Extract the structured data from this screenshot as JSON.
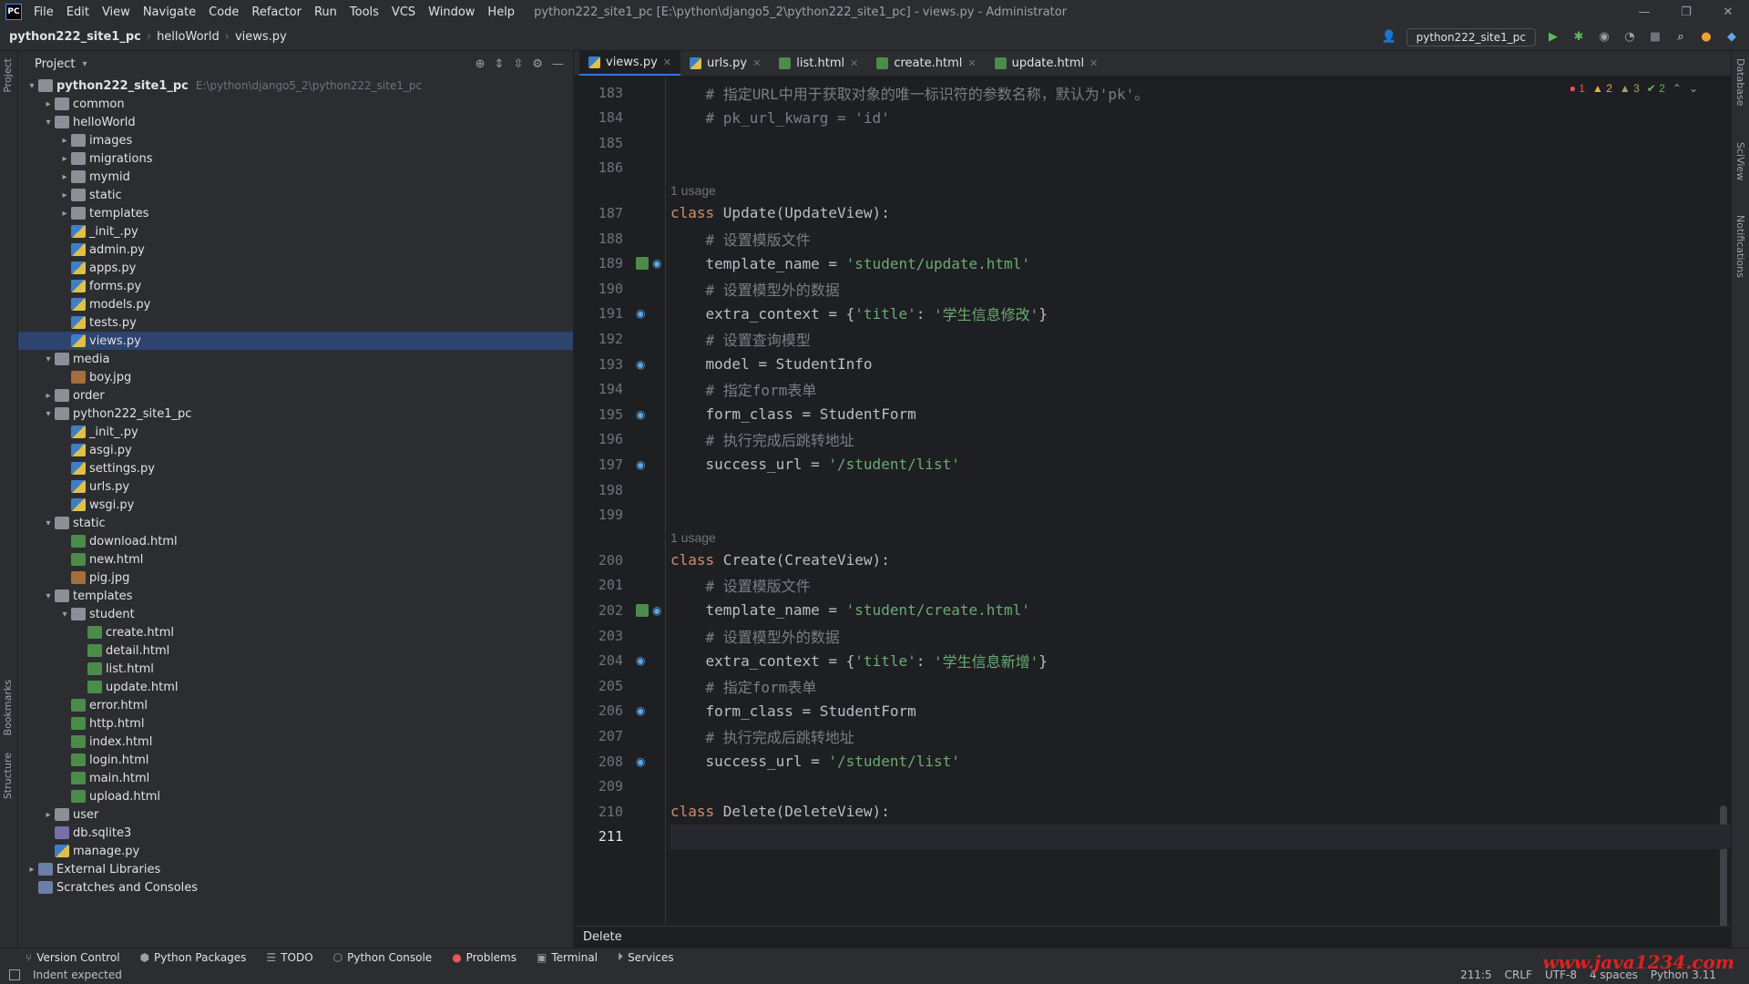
{
  "app": {
    "logo": "PC",
    "menu": [
      "File",
      "Edit",
      "View",
      "Navigate",
      "Code",
      "Refactor",
      "Run",
      "Tools",
      "VCS",
      "Window",
      "Help"
    ],
    "window_title": "python222_site1_pc [E:\\python\\django5_2\\python222_site1_pc] - views.py - Administrator"
  },
  "nav": {
    "crumbs": [
      "python222_site1_pc",
      "helloWorld",
      "views.py"
    ],
    "run_config": "python222_site1_pc"
  },
  "project": {
    "title": "Project",
    "tree": [
      {
        "depth": 0,
        "arrow": "▾",
        "icon": "folder",
        "label": "python222_site1_pc",
        "path": "E:\\python\\django5_2\\python222_site1_pc",
        "bold": true
      },
      {
        "depth": 1,
        "arrow": "▸",
        "icon": "folder",
        "label": "common"
      },
      {
        "depth": 1,
        "arrow": "▾",
        "icon": "folder",
        "label": "helloWorld"
      },
      {
        "depth": 2,
        "arrow": "▸",
        "icon": "folder",
        "label": "images"
      },
      {
        "depth": 2,
        "arrow": "▸",
        "icon": "folder",
        "label": "migrations"
      },
      {
        "depth": 2,
        "arrow": "▸",
        "icon": "folder",
        "label": "mymid"
      },
      {
        "depth": 2,
        "arrow": "▸",
        "icon": "folder",
        "label": "static"
      },
      {
        "depth": 2,
        "arrow": "▸",
        "icon": "folder",
        "label": "templates"
      },
      {
        "depth": 2,
        "arrow": "",
        "icon": "py",
        "label": "_init_.py"
      },
      {
        "depth": 2,
        "arrow": "",
        "icon": "py",
        "label": "admin.py"
      },
      {
        "depth": 2,
        "arrow": "",
        "icon": "py",
        "label": "apps.py"
      },
      {
        "depth": 2,
        "arrow": "",
        "icon": "py",
        "label": "forms.py"
      },
      {
        "depth": 2,
        "arrow": "",
        "icon": "py",
        "label": "models.py"
      },
      {
        "depth": 2,
        "arrow": "",
        "icon": "py",
        "label": "tests.py"
      },
      {
        "depth": 2,
        "arrow": "",
        "icon": "py",
        "label": "views.py",
        "selected": true
      },
      {
        "depth": 1,
        "arrow": "▾",
        "icon": "folder",
        "label": "media"
      },
      {
        "depth": 2,
        "arrow": "",
        "icon": "img",
        "label": "boy.jpg"
      },
      {
        "depth": 1,
        "arrow": "▸",
        "icon": "folder",
        "label": "order"
      },
      {
        "depth": 1,
        "arrow": "▾",
        "icon": "folder",
        "label": "python222_site1_pc"
      },
      {
        "depth": 2,
        "arrow": "",
        "icon": "py",
        "label": "_init_.py"
      },
      {
        "depth": 2,
        "arrow": "",
        "icon": "py",
        "label": "asgi.py"
      },
      {
        "depth": 2,
        "arrow": "",
        "icon": "py",
        "label": "settings.py"
      },
      {
        "depth": 2,
        "arrow": "",
        "icon": "py",
        "label": "urls.py"
      },
      {
        "depth": 2,
        "arrow": "",
        "icon": "py",
        "label": "wsgi.py"
      },
      {
        "depth": 1,
        "arrow": "▾",
        "icon": "folder",
        "label": "static"
      },
      {
        "depth": 2,
        "arrow": "",
        "icon": "html",
        "label": "download.html"
      },
      {
        "depth": 2,
        "arrow": "",
        "icon": "html",
        "label": "new.html"
      },
      {
        "depth": 2,
        "arrow": "",
        "icon": "img",
        "label": "pig.jpg"
      },
      {
        "depth": 1,
        "arrow": "▾",
        "icon": "folder",
        "label": "templates"
      },
      {
        "depth": 2,
        "arrow": "▾",
        "icon": "folder",
        "label": "student"
      },
      {
        "depth": 3,
        "arrow": "",
        "icon": "html",
        "label": "create.html"
      },
      {
        "depth": 3,
        "arrow": "",
        "icon": "html",
        "label": "detail.html"
      },
      {
        "depth": 3,
        "arrow": "",
        "icon": "html",
        "label": "list.html"
      },
      {
        "depth": 3,
        "arrow": "",
        "icon": "html",
        "label": "update.html"
      },
      {
        "depth": 2,
        "arrow": "",
        "icon": "html",
        "label": "error.html"
      },
      {
        "depth": 2,
        "arrow": "",
        "icon": "html",
        "label": "http.html"
      },
      {
        "depth": 2,
        "arrow": "",
        "icon": "html",
        "label": "index.html"
      },
      {
        "depth": 2,
        "arrow": "",
        "icon": "html",
        "label": "login.html"
      },
      {
        "depth": 2,
        "arrow": "",
        "icon": "html",
        "label": "main.html"
      },
      {
        "depth": 2,
        "arrow": "",
        "icon": "html",
        "label": "upload.html"
      },
      {
        "depth": 1,
        "arrow": "▸",
        "icon": "folder",
        "label": "user"
      },
      {
        "depth": 1,
        "arrow": "",
        "icon": "db",
        "label": "db.sqlite3"
      },
      {
        "depth": 1,
        "arrow": "",
        "icon": "py",
        "label": "manage.py"
      },
      {
        "depth": 0,
        "arrow": "▸",
        "icon": "lib",
        "label": "External Libraries"
      },
      {
        "depth": 0,
        "arrow": "",
        "icon": "lib",
        "label": "Scratches and Consoles"
      }
    ]
  },
  "tabs": [
    {
      "label": "views.py",
      "icon": "py",
      "active": true
    },
    {
      "label": "urls.py",
      "icon": "py"
    },
    {
      "label": "list.html",
      "icon": "html"
    },
    {
      "label": "create.html",
      "icon": "html"
    },
    {
      "label": "update.html",
      "icon": "html"
    }
  ],
  "inspections": {
    "errors": "1",
    "warnings": "2",
    "weak_warnings": "3",
    "ok": "2"
  },
  "code": {
    "lines": [
      {
        "n": "183",
        "parts": [
          [
            "cmt",
            "    # 指定URL中用于获取对象的唯一标识符的参数名称，默认为'pk'。"
          ]
        ]
      },
      {
        "n": "184",
        "parts": [
          [
            "cmt",
            "    # pk_url_kwarg = 'id'"
          ]
        ]
      },
      {
        "n": "185",
        "parts": []
      },
      {
        "n": "186",
        "parts": []
      },
      {
        "n": "187",
        "parts": [
          [
            "kw",
            "class "
          ],
          [
            "cls",
            "Update(UpdateView):"
          ]
        ],
        "usage_before": "1 usage"
      },
      {
        "n": "188",
        "parts": [
          [
            "cmt",
            "    # 设置模版文件"
          ]
        ]
      },
      {
        "n": "189",
        "parts": [
          [
            "cls",
            "    template_name = "
          ],
          [
            "str",
            "'student/update.html'"
          ]
        ],
        "marks": [
          "impl",
          "override"
        ]
      },
      {
        "n": "190",
        "parts": [
          [
            "cmt",
            "    # 设置模型外的数据"
          ]
        ]
      },
      {
        "n": "191",
        "parts": [
          [
            "cls",
            "    extra_context = {"
          ],
          [
            "str",
            "'title'"
          ],
          [
            "cls",
            ": "
          ],
          [
            "str",
            "'学生信息修改'"
          ],
          [
            "cls",
            "}"
          ]
        ],
        "marks": [
          "override"
        ]
      },
      {
        "n": "192",
        "parts": [
          [
            "cmt",
            "    # 设置查询模型"
          ]
        ]
      },
      {
        "n": "193",
        "parts": [
          [
            "cls",
            "    model = StudentInfo"
          ]
        ],
        "marks": [
          "override"
        ]
      },
      {
        "n": "194",
        "parts": [
          [
            "cmt",
            "    # 指定form表单"
          ]
        ]
      },
      {
        "n": "195",
        "parts": [
          [
            "cls",
            "    form_class = StudentForm"
          ]
        ],
        "marks": [
          "override"
        ]
      },
      {
        "n": "196",
        "parts": [
          [
            "cmt",
            "    # 执行完成后跳转地址"
          ]
        ]
      },
      {
        "n": "197",
        "parts": [
          [
            "cls",
            "    success_url = "
          ],
          [
            "str",
            "'/student/list'"
          ]
        ],
        "marks": [
          "override"
        ]
      },
      {
        "n": "198",
        "parts": []
      },
      {
        "n": "199",
        "parts": []
      },
      {
        "n": "200",
        "parts": [
          [
            "kw",
            "class "
          ],
          [
            "cls",
            "Create(CreateView):"
          ]
        ],
        "usage_before": "1 usage"
      },
      {
        "n": "201",
        "parts": [
          [
            "cmt",
            "    # 设置模版文件"
          ]
        ]
      },
      {
        "n": "202",
        "parts": [
          [
            "cls",
            "    template_name = "
          ],
          [
            "str",
            "'student/create.html'"
          ]
        ],
        "marks": [
          "impl",
          "override"
        ]
      },
      {
        "n": "203",
        "parts": [
          [
            "cmt",
            "    # 设置模型外的数据"
          ]
        ]
      },
      {
        "n": "204",
        "parts": [
          [
            "cls",
            "    extra_context = {"
          ],
          [
            "str",
            "'title'"
          ],
          [
            "cls",
            ": "
          ],
          [
            "str",
            "'学生信息新增'"
          ],
          [
            "cls",
            "}"
          ]
        ],
        "marks": [
          "override"
        ]
      },
      {
        "n": "205",
        "parts": [
          [
            "cmt",
            "    # 指定form表单"
          ]
        ]
      },
      {
        "n": "206",
        "parts": [
          [
            "cls",
            "    form_class = StudentForm"
          ]
        ],
        "marks": [
          "override"
        ]
      },
      {
        "n": "207",
        "parts": [
          [
            "cmt",
            "    # 执行完成后跳转地址"
          ]
        ]
      },
      {
        "n": "208",
        "parts": [
          [
            "cls",
            "    success_url = "
          ],
          [
            "str",
            "'/student/list'"
          ]
        ],
        "marks": [
          "override"
        ]
      },
      {
        "n": "209",
        "parts": []
      },
      {
        "n": "210",
        "parts": [
          [
            "kw",
            "class "
          ],
          [
            "cls",
            "Delete(DeleteView):"
          ]
        ]
      },
      {
        "n": "211",
        "parts": [],
        "current": true
      }
    ]
  },
  "editor_breadcrumb": "Delete",
  "toolwindows": [
    "Version Control",
    "Python Packages",
    "TODO",
    "Python Console",
    "Problems",
    "Terminal",
    "Services"
  ],
  "left_labels": [
    "Project",
    "Bookmarks",
    "Structure"
  ],
  "right_labels": [
    "Database",
    "SciView",
    "Notifications"
  ],
  "status": {
    "message": "Indent expected",
    "position": "211:5",
    "line_sep": "CRLF",
    "encoding": "UTF-8",
    "indent": "4 spaces",
    "interpreter": "Python 3.11"
  },
  "watermark": "www.java1234.com"
}
